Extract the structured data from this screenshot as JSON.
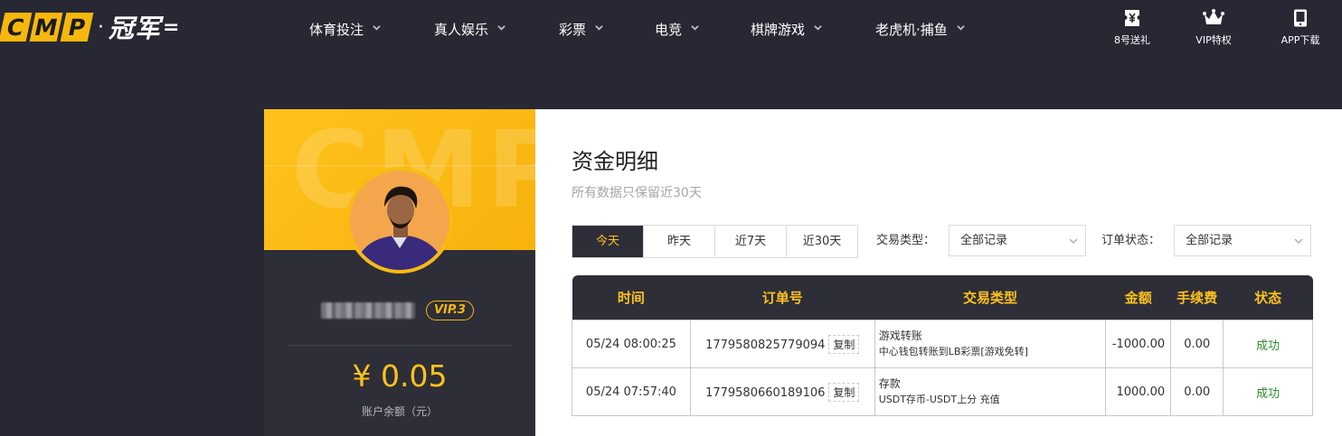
{
  "logo": {
    "tiles": [
      "C",
      "M",
      "P"
    ],
    "dot": "·",
    "cn": "冠军",
    "tail": "="
  },
  "nav": [
    {
      "label": "体育投注"
    },
    {
      "label": "真人娱乐"
    },
    {
      "label": "彩票"
    },
    {
      "label": "电竞"
    },
    {
      "label": "棋牌游戏"
    },
    {
      "label": "老虎机·捕鱼"
    }
  ],
  "top_right": [
    {
      "label": "8号送礼",
      "icon": "ticket-icon"
    },
    {
      "label": "VIP特权",
      "icon": "crown-icon"
    },
    {
      "label": "APP下载",
      "icon": "phone-icon"
    }
  ],
  "profile": {
    "watermark": "CMP",
    "vip": "VIP.3",
    "balance": "¥ 0.05",
    "balance_label": "账户余额（元）"
  },
  "page": {
    "title": "资金明细",
    "subtitle": "所有数据只保留近30天"
  },
  "filters": {
    "tabs": [
      {
        "label": "今天",
        "active": true
      },
      {
        "label": "昨天",
        "active": false
      },
      {
        "label": "近7天",
        "active": false
      },
      {
        "label": "近30天",
        "active": false
      }
    ],
    "trade_type_label": "交易类型：",
    "trade_type_value": "全部记录",
    "order_status_label": "订单状态：",
    "order_status_value": "全部记录"
  },
  "table": {
    "headers": [
      "时间",
      "订单号",
      "交易类型",
      "金额",
      "手续费",
      "状态"
    ],
    "copy_label": "复制",
    "rows": [
      {
        "time": "05/24 08:00:25",
        "order": "1779580825779094",
        "type_main": "游戏转账",
        "type_sub": "中心钱包转账到LB彩票[游戏免转]",
        "amount": "-1000.00",
        "fee": "0.00",
        "status": "成功"
      },
      {
        "time": "05/24 07:57:40",
        "order": "1779580660189106",
        "type_main": "存款",
        "type_sub": "USDT存币-USDT上分 充值",
        "amount": "1000.00",
        "fee": "0.00",
        "status": "成功"
      }
    ]
  },
  "colors": {
    "accent": "#ffc21c",
    "dark": "#272833",
    "panel": "#2d2e37",
    "success": "#2e8b2e"
  }
}
